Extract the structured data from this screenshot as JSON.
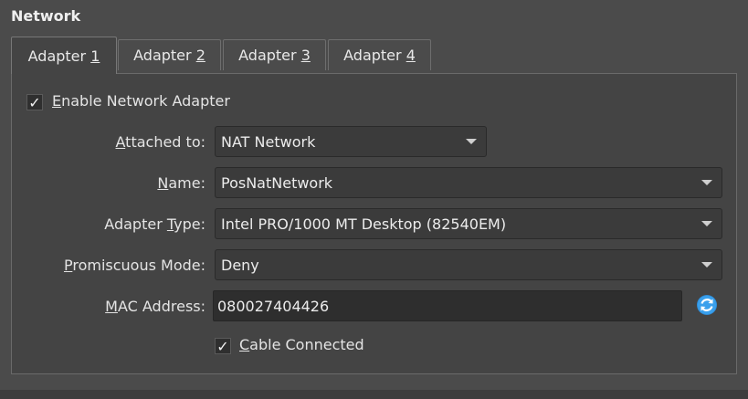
{
  "section": {
    "title": "Network"
  },
  "tabs": [
    {
      "prefix": "Adapter ",
      "mnemonic": "1",
      "active": true
    },
    {
      "prefix": "Adapter ",
      "mnemonic": "2",
      "active": false
    },
    {
      "prefix": "Adapter ",
      "mnemonic": "3",
      "active": false
    },
    {
      "prefix": "Adapter ",
      "mnemonic": "4",
      "active": false
    }
  ],
  "enable_adapter": {
    "mnemonic": "E",
    "rest": "nable Network Adapter",
    "checked": true,
    "check_glyph": "✓"
  },
  "attached_to": {
    "mnemonic": "A",
    "rest": "ttached to:",
    "value": "NAT Network"
  },
  "name": {
    "mnemonic": "N",
    "rest": "ame:",
    "value": "PosNatNetwork"
  },
  "adapter_type": {
    "pre": "Adapter ",
    "mnemonic": "T",
    "rest": "ype:",
    "value": "Intel PRO/1000 MT Desktop (82540EM)"
  },
  "promiscuous": {
    "mnemonic": "P",
    "rest": "romiscuous Mode:",
    "value": "Deny"
  },
  "mac_address": {
    "mnemonic": "M",
    "rest": "AC Address:",
    "value": "080027404426",
    "refresh_icon": "refresh-icon"
  },
  "cable_connected": {
    "mnemonic": "C",
    "rest": "able Connected",
    "checked": true,
    "check_glyph": "✓"
  },
  "colors": {
    "background": "#4b4b4b",
    "panel": "#444444",
    "refresh_accent": "#2f8fdc"
  }
}
